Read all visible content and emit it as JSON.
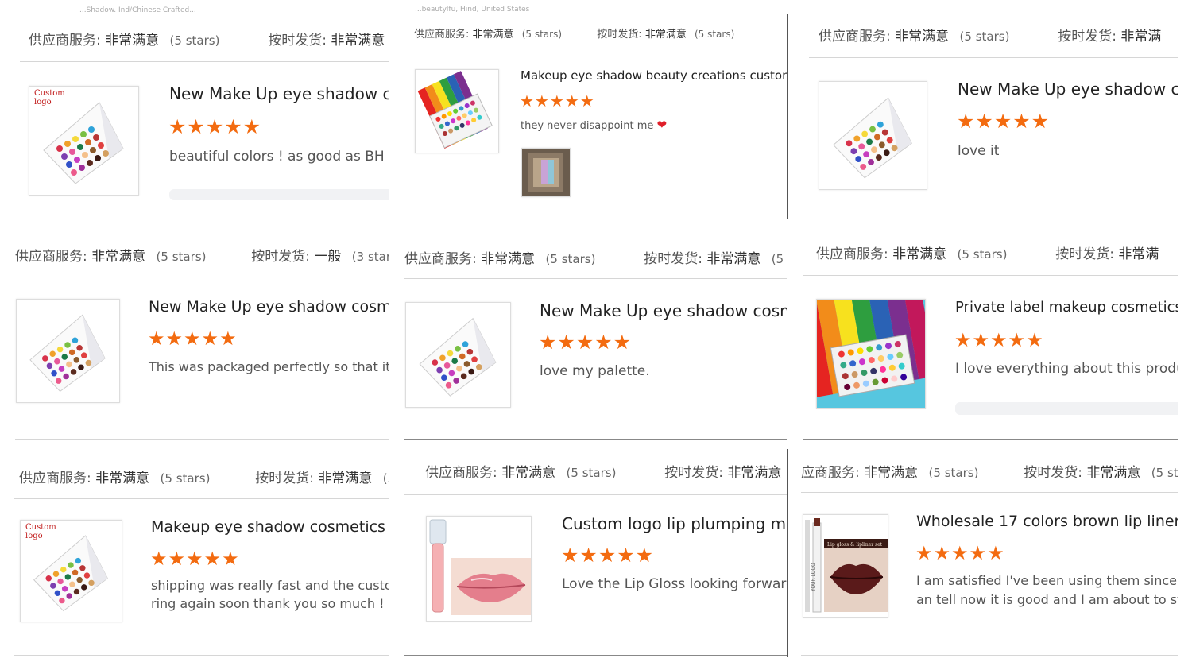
{
  "header_labels": {
    "service": "供应商服务:",
    "shipping": "按时发货:",
    "very_satisfied": "非常满意",
    "average": "一般",
    "five_stars": "(5 stars)",
    "three_stars": "(3 stars)",
    "five_trunc": "(5",
    "five_sta": "(5 sta",
    "service_trunc": "应商服务:",
    "very_satisfied_trunc": "非常满",
    "very_satisfied_trunc_e": "非常满意"
  },
  "faint_text": {
    "t1": "...Shadow. Ind/Chinese Crafted...",
    "t2": "...beautylfu, Hind, United States"
  },
  "stars_glyph": "★★★★★",
  "reviews": [
    {
      "title": "New Make Up eye shadow co",
      "text": "beautiful colors ! as good as BH C",
      "thumb_label": "Custom\nlogo"
    },
    {
      "title": "Makeup eye shadow beauty creations custom",
      "text": "they never disappoint me",
      "heart": "❤"
    },
    {
      "title": "New Make Up eye shadow co",
      "text": "love it"
    },
    {
      "title": "New Make Up eye shadow cosme",
      "text": "This was packaged perfectly so that it"
    },
    {
      "title": "New Make Up eye shadow cosme",
      "text": "love my palette."
    },
    {
      "title": "Private label makeup cosmetics r",
      "text": "I love everything about this produ"
    },
    {
      "title": "Makeup eye shadow cosmetics cu",
      "text_line1": "shipping was really fast and the custor",
      "text_line2": "ring again soon thank you so much !",
      "emoji": "😅",
      "thumb_label": "Custom\nlogo"
    },
    {
      "title": "Custom logo lip plumping mois",
      "text": "Love the Lip Gloss looking forward"
    },
    {
      "title": "Wholesale 17 colors brown lip liner a",
      "text_line1": "I am satisfied I've been using them since I",
      "text_line2": "an tell now it is good and I am about to sta",
      "product_label": "Lip gloss & lipliner set",
      "side_label": "YOUR LOGO"
    }
  ],
  "colors": {
    "star": "#f36b10",
    "divider": "#d6d6d6",
    "heart": "#e0202a"
  }
}
